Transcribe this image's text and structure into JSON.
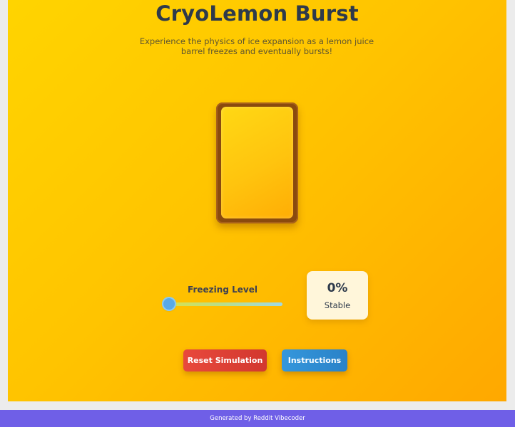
{
  "app": {
    "title": "CryoLemon Burst",
    "subtitle": "Experience the physics of ice expansion as a lemon juice barrel freezes and eventually bursts!"
  },
  "barrel": {
    "juice_color": "#ffc40e",
    "rim_color": "#8a4a0e"
  },
  "freezing": {
    "label": "Freezing Level",
    "value_fraction": 0.0
  },
  "status": {
    "percent": "0%",
    "state": "Stable"
  },
  "buttons": {
    "reset_label": "Reset Simulation",
    "instructions_label": "Instructions"
  },
  "footer": {
    "text": "Generated by Reddit Vibecoder"
  },
  "colors": {
    "background_gradient_start": "#ffd400",
    "background_gradient_end": "#ffa800",
    "reset_button": "#e8493c",
    "instructions_button": "#3597dc",
    "footer_bar": "#6f5fe7"
  }
}
